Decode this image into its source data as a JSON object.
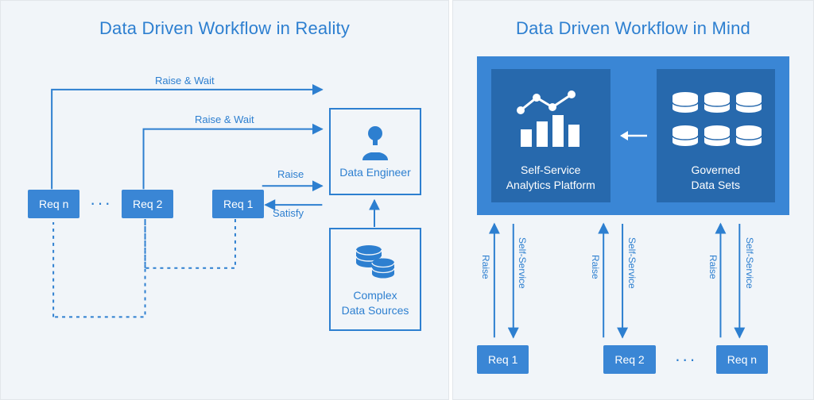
{
  "left": {
    "title": "Data Driven Workflow in Reality",
    "req_n": "Req n",
    "req_2": "Req 2",
    "req_1": "Req 1",
    "ellipsis": "···",
    "engineer_label": "Data Engineer",
    "sources_label": "Complex\nData Sources",
    "raise_wait": "Raise & Wait",
    "raise": "Raise",
    "satisfy": "Satisfy"
  },
  "right": {
    "title": "Data Driven Workflow in Mind",
    "platform_label": "Self-Service\nAnalytics Platform",
    "datasets_label": "Governed\nData Sets",
    "req_1": "Req 1",
    "req_2": "Req 2",
    "req_n": "Req n",
    "ellipsis": "···",
    "raise": "Raise",
    "self_service": "Self-Service"
  }
}
